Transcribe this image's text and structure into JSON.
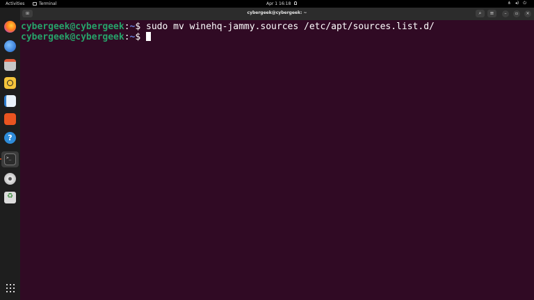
{
  "topbar": {
    "activities": "Activities",
    "app_name": "Terminal",
    "clock": "Apr 1  16:18",
    "tray_icons": [
      "network-icon",
      "volume-icon",
      "power-icon",
      "menu-icon"
    ]
  },
  "dock": {
    "apps": [
      "firefox-icon",
      "thunderbird-icon",
      "files-icon",
      "rhythmbox-icon",
      "libreoffice-writer-icon",
      "app-center-icon",
      "help-icon",
      "terminal-icon",
      "disc-icon",
      "trash-icon",
      "show-apps-icon"
    ],
    "terminal_glyph": ">_"
  },
  "window": {
    "title": "cybergeek@cybergeek: ~",
    "new_tab_glyph": "⊞",
    "search_glyph": "⌕",
    "menu_glyph": "≡",
    "minimize_glyph": "–",
    "maximize_glyph": "▫",
    "close_glyph": "×"
  },
  "terminal": {
    "lines": [
      {
        "user": "cybergeek@cybergeek",
        "sep": ":",
        "path": "~",
        "prompt": "$ ",
        "command": "sudo mv winehq-jammy.sources /etc/apt/sources.list.d/"
      },
      {
        "user": "cybergeek@cybergeek",
        "sep": ":",
        "path": "~",
        "prompt": "$ ",
        "command": ""
      }
    ]
  },
  "colors": {
    "terminal_bg": "#300a24",
    "user_green": "#26a269",
    "path_blue": "#6a7fd8",
    "accent": "#e95420"
  }
}
